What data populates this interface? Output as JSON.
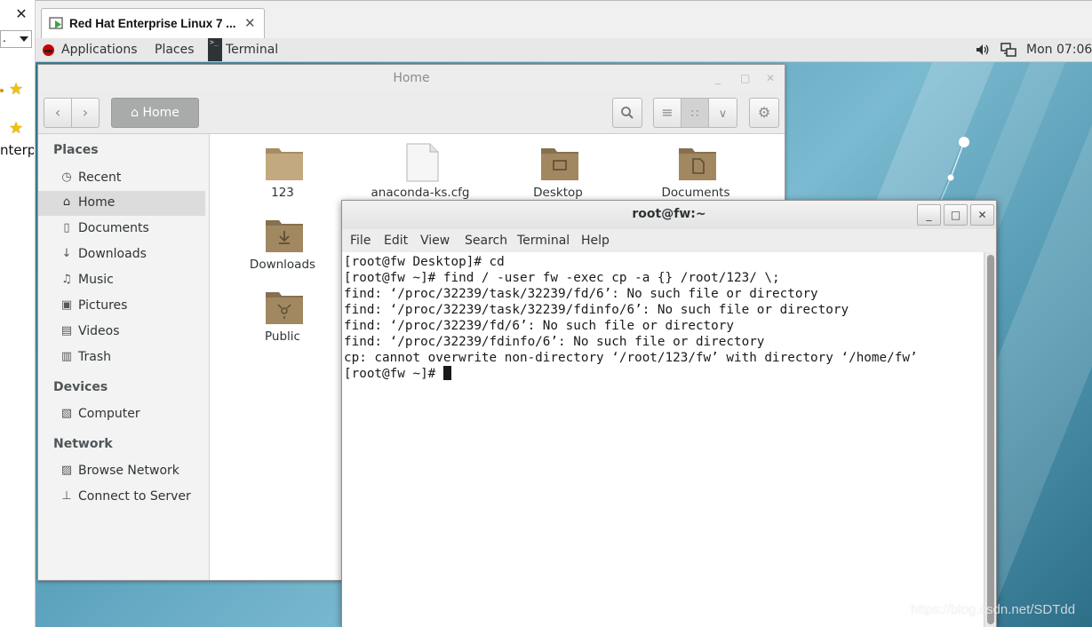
{
  "host": {
    "close_glyph": "✕",
    "dropdown_text": "."
  },
  "vm_tab": {
    "title": "Red Hat Enterprise Linux 7 ...",
    "close_glyph": "✕"
  },
  "left_partial_text": "nterpr",
  "topbar": {
    "applications": "Applications",
    "places": "Places",
    "terminal": "Terminal",
    "clock": "Mon 07:06"
  },
  "files": {
    "title": "Home",
    "minimize": "_",
    "maximize": "□",
    "close": "✕",
    "path_label": "Home",
    "sidebar": {
      "places_heading": "Places",
      "places": [
        "Recent",
        "Home",
        "Documents",
        "Downloads",
        "Music",
        "Pictures",
        "Videos",
        "Trash"
      ],
      "devices_heading": "Devices",
      "devices": [
        "Computer"
      ],
      "network_heading": "Network",
      "network": [
        "Browse Network",
        "Connect to Server"
      ]
    },
    "items": [
      "123",
      "anaconda-ks.cfg",
      "Desktop",
      "Documents",
      "Downloads",
      "Public"
    ]
  },
  "terminal": {
    "title": "root@fw:~",
    "menu": [
      "File",
      "Edit",
      "View",
      "Search",
      "Terminal",
      "Help"
    ],
    "lines": [
      "[root@fw Desktop]# cd",
      "[root@fw ~]# find / -user fw -exec cp -a {} /root/123/ \\;",
      "find: ‘/proc/32239/task/32239/fd/6’: No such file or directory",
      "find: ‘/proc/32239/task/32239/fdinfo/6’: No such file or directory",
      "find: ‘/proc/32239/fd/6’: No such file or directory",
      "find: ‘/proc/32239/fdinfo/6’: No such file or directory",
      "cp: cannot overwrite non-directory ‘/root/123/fw’ with directory ‘/home/fw’"
    ],
    "prompt": "[root@fw ~]# "
  },
  "watermark": "https://blog.csdn.net/SDTdd",
  "colors": {
    "desktop": "#5fa4bf",
    "redhat_red": "#cc0000",
    "folder": "#bca27a"
  }
}
